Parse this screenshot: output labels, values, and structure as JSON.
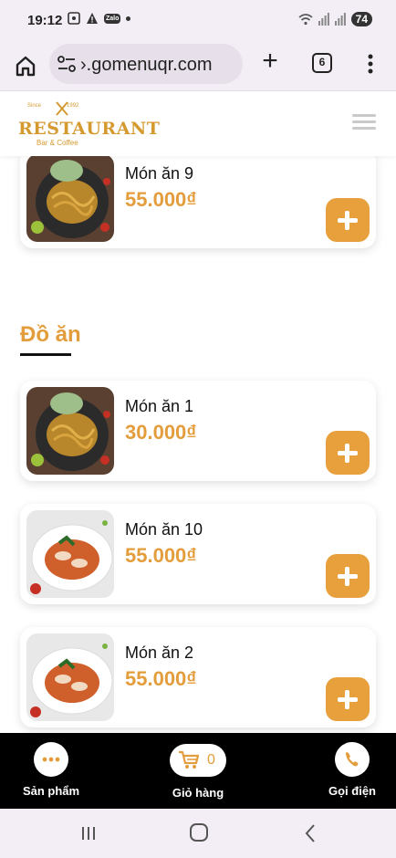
{
  "status_bar": {
    "time": "19:12",
    "battery": "74"
  },
  "browser": {
    "url": "›.gomenuqr.com",
    "tab_count": "6"
  },
  "header": {
    "logo_since": "Since",
    "logo_year": "1992",
    "logo_name": "RESTAURANT",
    "logo_subtitle": "Bar & Coffee"
  },
  "menu": {
    "top_card": {
      "name": "Món ăn 9",
      "price": "55.000₫",
      "image": "noodle-dish"
    },
    "section_title": "Đồ ăn",
    "items": [
      {
        "name": "Món ăn 1",
        "price": "30.000₫",
        "image": "noodle-dish"
      },
      {
        "name": "Món ăn 10",
        "price": "55.000₫",
        "image": "squid-dish"
      },
      {
        "name": "Món ăn 2",
        "price": "55.000₫",
        "image": "squid-dish"
      }
    ]
  },
  "bottom_bar": {
    "products_label": "Sản phẩm",
    "cart_label": "Giỏ hàng",
    "cart_count": "0",
    "call_label": "Gọi điện"
  },
  "colors": {
    "accent": "#e49d3c",
    "button": "#e8a03c",
    "bottom_bar": "#000000"
  }
}
